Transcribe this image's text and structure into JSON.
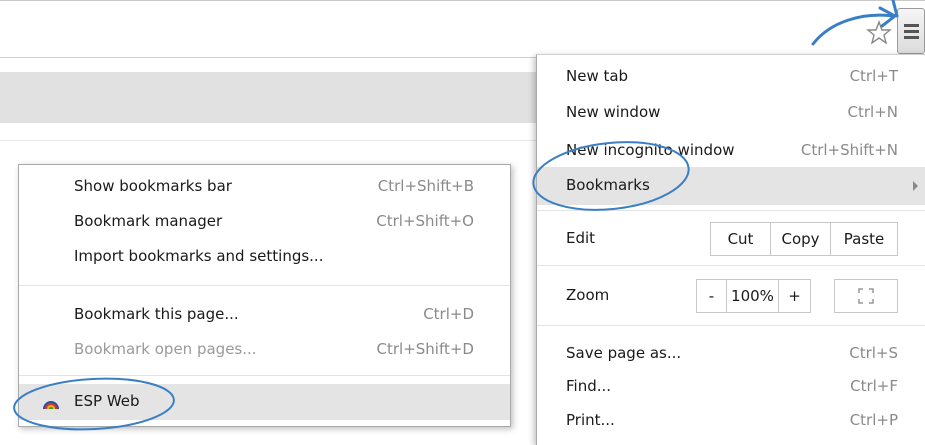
{
  "menu": {
    "new_tab": {
      "label": "New tab",
      "shortcut": "Ctrl+T"
    },
    "new_window": {
      "label": "New window",
      "shortcut": "Ctrl+N"
    },
    "new_incognito": {
      "label": "New incognito window",
      "shortcut": "Ctrl+Shift+N"
    },
    "bookmarks": {
      "label": "Bookmarks"
    },
    "edit": {
      "label": "Edit",
      "cut": "Cut",
      "copy": "Copy",
      "paste": "Paste"
    },
    "zoom": {
      "label": "Zoom",
      "minus": "-",
      "level": "100%",
      "plus": "+"
    },
    "save_page": {
      "label": "Save page as...",
      "shortcut": "Ctrl+S"
    },
    "find": {
      "label": "Find...",
      "shortcut": "Ctrl+F"
    },
    "print": {
      "label": "Print...",
      "shortcut": "Ctrl+P"
    }
  },
  "bookmarks_menu": {
    "show_bar": {
      "label": "Show bookmarks bar",
      "shortcut": "Ctrl+Shift+B"
    },
    "manager": {
      "label": "Bookmark manager",
      "shortcut": "Ctrl+Shift+O"
    },
    "import": {
      "label": "Import bookmarks and settings..."
    },
    "bookmark_page": {
      "label": "Bookmark this page...",
      "shortcut": "Ctrl+D"
    },
    "bookmark_open": {
      "label": "Bookmark open pages...",
      "shortcut": "Ctrl+Shift+D"
    },
    "esp_web": {
      "label": "ESP Web"
    }
  },
  "colors": {
    "annotation": "#3a7fc4",
    "highlight": "#e4e4e4",
    "shortcut_text": "#8a8a8a"
  },
  "icons": [
    "star-icon",
    "menu-icon",
    "submenu-arrow-icon",
    "fullscreen-icon",
    "esp-web-favicon"
  ]
}
